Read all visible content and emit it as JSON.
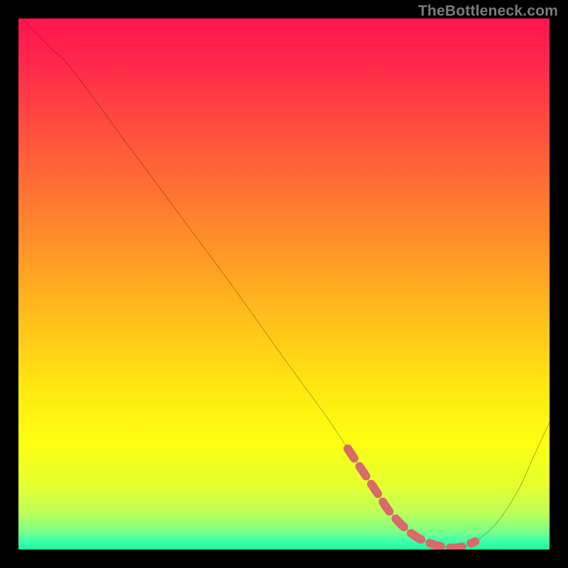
{
  "watermark": {
    "text": "TheBottleneck.com"
  },
  "gradient": {
    "stops": [
      {
        "offset": 0.0,
        "color": "#ff1450"
      },
      {
        "offset": 0.09,
        "color": "#ff2a4a"
      },
      {
        "offset": 0.2,
        "color": "#ff4c3f"
      },
      {
        "offset": 0.32,
        "color": "#ff7033"
      },
      {
        "offset": 0.45,
        "color": "#ff9a26"
      },
      {
        "offset": 0.58,
        "color": "#ffc41a"
      },
      {
        "offset": 0.7,
        "color": "#ffe910"
      },
      {
        "offset": 0.8,
        "color": "#fcff12"
      },
      {
        "offset": 0.88,
        "color": "#e4ff2f"
      },
      {
        "offset": 0.93,
        "color": "#bdff58"
      },
      {
        "offset": 0.965,
        "color": "#7dff86"
      },
      {
        "offset": 0.985,
        "color": "#3dffad"
      },
      {
        "offset": 1.0,
        "color": "#17f59a"
      }
    ]
  },
  "chart_data": {
    "type": "line",
    "title": "",
    "xlabel": "",
    "ylabel": "",
    "xlim": [
      0,
      100
    ],
    "ylim": [
      0,
      100
    ],
    "series": [
      {
        "name": "curve",
        "x": [
          0.7,
          6.0,
          10.0,
          20.0,
          30.0,
          40.0,
          50.0,
          58.0,
          62.0,
          65.0,
          68.0,
          70.0,
          74.0,
          78.0,
          81.0,
          83.0,
          86.0,
          90.0,
          94.0,
          97.0,
          100.0
        ],
        "y": [
          100.0,
          94.5,
          90.5,
          77.0,
          63.5,
          50.0,
          36.0,
          25.0,
          19.0,
          14.5,
          10.0,
          7.0,
          3.0,
          1.0,
          0.4,
          0.4,
          1.5,
          5.0,
          11.0,
          17.5,
          24.0
        ]
      }
    ],
    "highlight": {
      "name": "bottom-band",
      "color": "#d86a6a",
      "x": [
        62.0,
        65.0,
        68.0,
        70.0,
        74.0,
        78.0,
        81.0,
        83.0,
        86.0
      ],
      "y": [
        19.0,
        14.5,
        10.0,
        7.0,
        3.0,
        1.0,
        0.4,
        0.4,
        1.5
      ]
    }
  }
}
